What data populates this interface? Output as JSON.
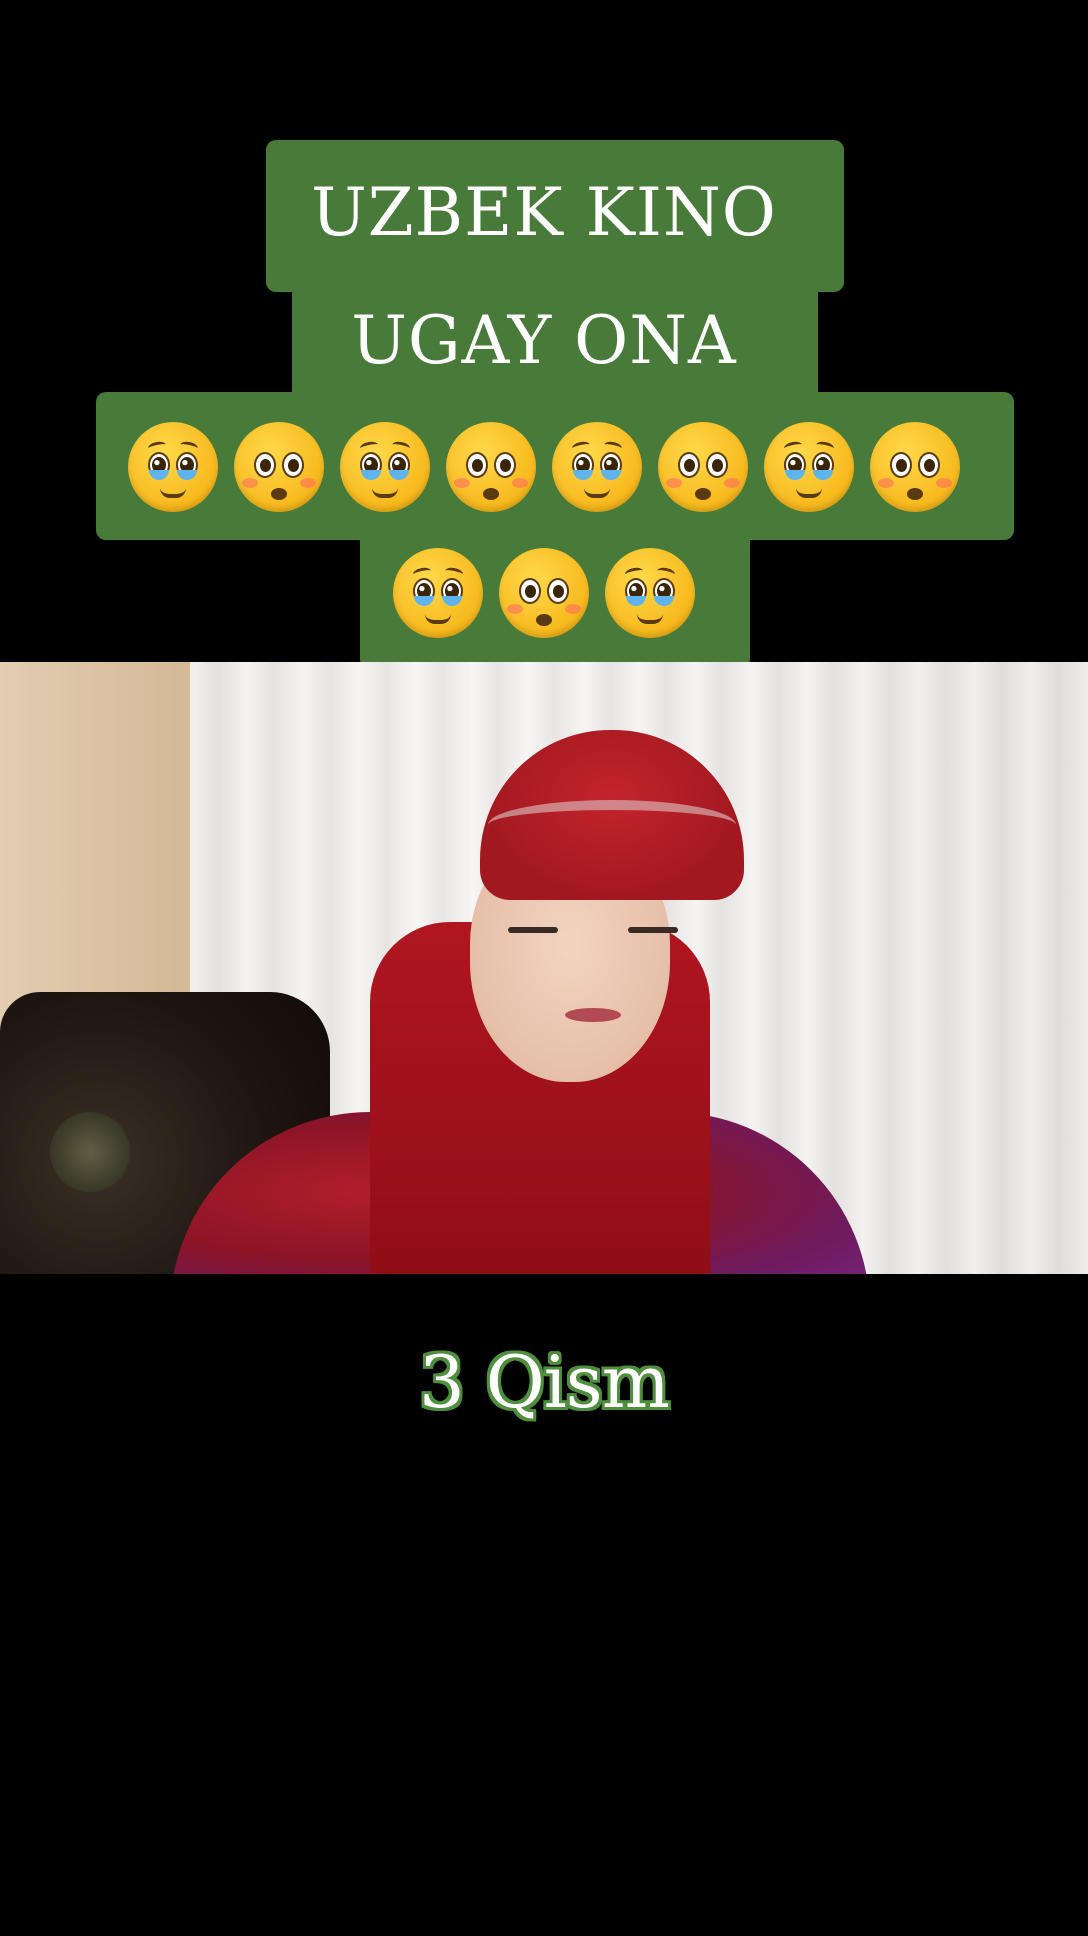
{
  "title": {
    "line1": "UZBEK KINO",
    "line2": "UGAY ONA"
  },
  "emojis": {
    "row1": [
      "pleading-face",
      "flushed-face",
      "pleading-face",
      "flushed-face",
      "pleading-face",
      "flushed-face",
      "pleading-face",
      "flushed-face"
    ],
    "row2": [
      "pleading-face",
      "flushed-face",
      "pleading-face"
    ]
  },
  "episode_label": "3 Qism",
  "colors": {
    "title_block": "#487a3a",
    "background": "#000000",
    "episode_outline": "#4e8e3c"
  }
}
